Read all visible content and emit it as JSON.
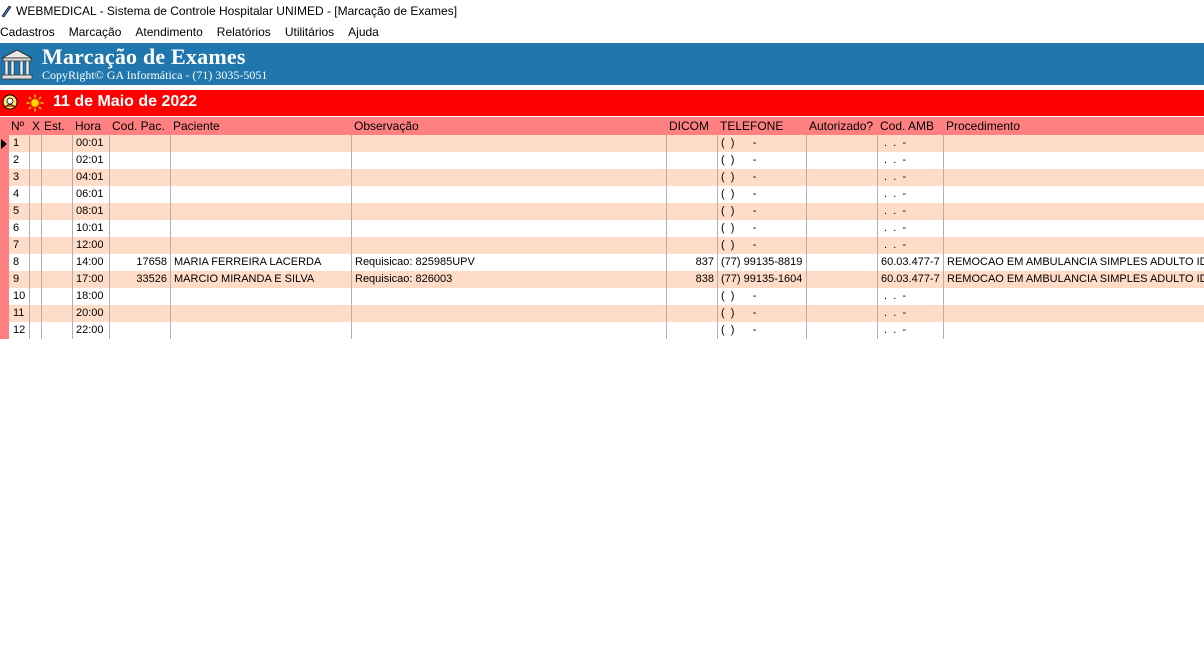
{
  "window": {
    "title": "WEBMEDICAL - Sistema de Controle Hospitalar UNIMED - [Marcação de Exames]"
  },
  "menu": [
    "Cadastros",
    "Marcação",
    "Atendimento",
    "Relatórios",
    "Utilitários",
    "Ajuda"
  ],
  "banner": {
    "title": "Marcação de Exames",
    "copyright": "CopyRight© GA Informática - (71) 3035-5051"
  },
  "date_bar": {
    "date": "11 de Maio de 2022"
  },
  "table": {
    "headers": [
      "Nº",
      "X",
      "Est.",
      "Hora",
      "Cod. Pac.",
      "Paciente",
      "Observação",
      "DICOM",
      "TELEFONE",
      "Autorizado?",
      "Cod. AMB",
      "Procedimento"
    ],
    "rows": [
      {
        "no": "1",
        "x": "",
        "est": "",
        "hora": "00:01",
        "cod": "",
        "paciente": "",
        "obs": "",
        "dicom": "",
        "tel": "(  )      -",
        "aut": "",
        "amb": " .  .  -",
        "proc": ""
      },
      {
        "no": "2",
        "x": "",
        "est": "",
        "hora": "02:01",
        "cod": "",
        "paciente": "",
        "obs": "",
        "dicom": "",
        "tel": "(  )      -",
        "aut": "",
        "amb": " .  .  -",
        "proc": ""
      },
      {
        "no": "3",
        "x": "",
        "est": "",
        "hora": "04:01",
        "cod": "",
        "paciente": "",
        "obs": "",
        "dicom": "",
        "tel": "(  )      -",
        "aut": "",
        "amb": " .  .  -",
        "proc": ""
      },
      {
        "no": "4",
        "x": "",
        "est": "",
        "hora": "06:01",
        "cod": "",
        "paciente": "",
        "obs": "",
        "dicom": "",
        "tel": "(  )      -",
        "aut": "",
        "amb": " .  .  -",
        "proc": ""
      },
      {
        "no": "5",
        "x": "",
        "est": "",
        "hora": "08:01",
        "cod": "",
        "paciente": "",
        "obs": "",
        "dicom": "",
        "tel": "(  )      -",
        "aut": "",
        "amb": " .  .  -",
        "proc": ""
      },
      {
        "no": "6",
        "x": "",
        "est": "",
        "hora": "10:01",
        "cod": "",
        "paciente": "",
        "obs": "",
        "dicom": "",
        "tel": "(  )      -",
        "aut": "",
        "amb": " .  .  -",
        "proc": ""
      },
      {
        "no": "7",
        "x": "",
        "est": "",
        "hora": "12:00",
        "cod": "",
        "paciente": "",
        "obs": "",
        "dicom": "",
        "tel": "(  )      -",
        "aut": "",
        "amb": " .  .  -",
        "proc": ""
      },
      {
        "no": "8",
        "x": "",
        "est": "",
        "hora": "14:00",
        "cod": "17658",
        "paciente": "MARIA FERREIRA LACERDA",
        "obs": "Requisicao: 825985UPV",
        "dicom": "837",
        "tel": "(77) 99135-8819",
        "aut": "",
        "amb": "60.03.477-7",
        "proc": "REMOCAO EM AMBULANCIA SIMPLES ADULTO IDA E"
      },
      {
        "no": "9",
        "x": "",
        "est": "",
        "hora": "17:00",
        "cod": "33526",
        "paciente": "MARCIO MIRANDA E SILVA",
        "obs": "Requisicao: 826003",
        "dicom": "838",
        "tel": "(77) 99135-1604",
        "aut": "",
        "amb": "60.03.477-7",
        "proc": "REMOCAO EM AMBULANCIA SIMPLES ADULTO IDA E"
      },
      {
        "no": "10",
        "x": "",
        "est": "",
        "hora": "18:00",
        "cod": "",
        "paciente": "",
        "obs": "",
        "dicom": "",
        "tel": "(  )      -",
        "aut": "",
        "amb": " .  .  -",
        "proc": ""
      },
      {
        "no": "11",
        "x": "",
        "est": "",
        "hora": "20:00",
        "cod": "",
        "paciente": "",
        "obs": "",
        "dicom": "",
        "tel": "(  )      -",
        "aut": "",
        "amb": " .  .  -",
        "proc": ""
      },
      {
        "no": "12",
        "x": "",
        "est": "",
        "hora": "22:00",
        "cod": "",
        "paciente": "",
        "obs": "",
        "dicom": "",
        "tel": "(  )      -",
        "aut": "",
        "amb": " .  .  -",
        "proc": ""
      }
    ],
    "selected_row": 1
  },
  "colors": {
    "banner": "#1f77ae",
    "date_bar": "#ff0000",
    "header_row": "#ff8080",
    "row_alt": "#ffdcc8"
  }
}
